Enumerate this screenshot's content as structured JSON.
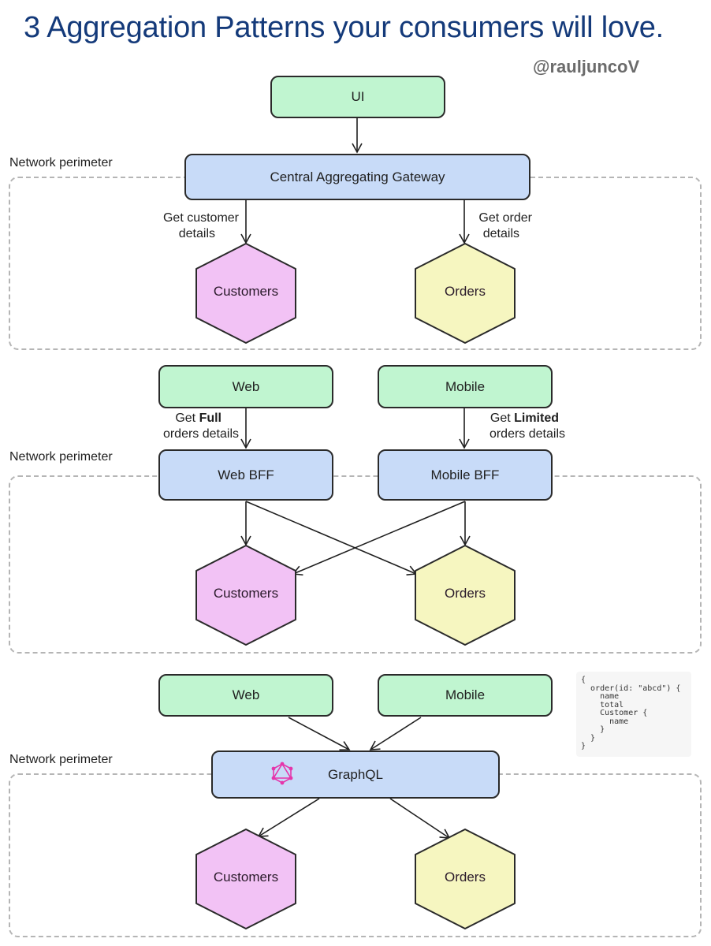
{
  "title": "3  Aggregation Patterns your consumers will love.",
  "handle": "@rauljuncoV",
  "colors": {
    "title": "#143a7a",
    "client_box": "#c0f5d0",
    "gateway_box": "#c8dbf8",
    "customers_service": "#f2c2f5",
    "orders_service": "#f6f6c0",
    "perimeter_dash": "#b5b5b5",
    "graphql_icon": "#e535ab"
  },
  "pattern1": {
    "perimeter_label": "Network perimeter",
    "client": "UI",
    "gateway": "Central Aggregating Gateway",
    "edge_left": [
      "Get customer",
      "details"
    ],
    "edge_right": [
      "Get order",
      "details"
    ],
    "service_left": "Customers",
    "service_right": "Orders"
  },
  "pattern2": {
    "perimeter_label": "Network perimeter",
    "client_left": "Web",
    "client_right": "Mobile",
    "edge_left": {
      "prefix": "Get ",
      "bold": "Full",
      "line2": "orders details"
    },
    "edge_right": {
      "prefix": "Get ",
      "bold": "Limited",
      "line2": "orders details"
    },
    "bff_left": "Web BFF",
    "bff_right": "Mobile BFF",
    "service_left": "Customers",
    "service_right": "Orders"
  },
  "pattern3": {
    "perimeter_label": "Network perimeter",
    "client_left": "Web",
    "client_right": "Mobile",
    "gateway": "GraphQL",
    "gateway_icon": "graphql-logo",
    "service_left": "Customers",
    "service_right": "Orders",
    "query_lines": [
      "{",
      "  order(id: \"abcd\") {",
      "    name",
      "    total",
      "    Customer {",
      "      name",
      "    }",
      "  }",
      "}"
    ]
  }
}
